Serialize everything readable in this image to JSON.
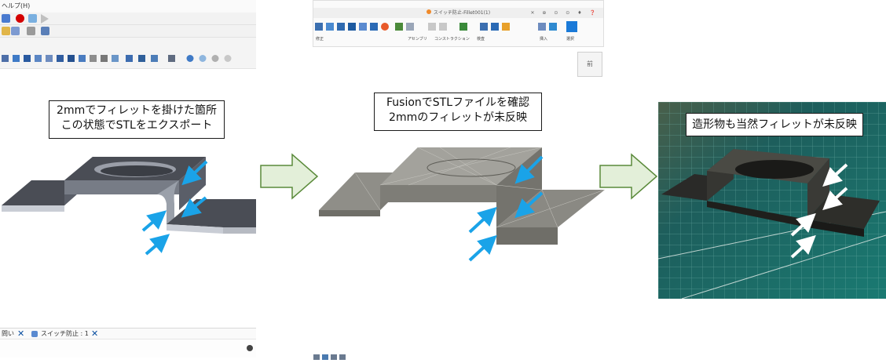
{
  "left_app": {
    "menu_help": "ヘルプ(H)",
    "tabs": [
      {
        "label": "問い"
      },
      {
        "label": "スイッチ防止 : 1"
      }
    ]
  },
  "middle_app": {
    "title": "スイッチ防止-Fillet001(1)",
    "toolbar_groups": [
      "修正",
      "アセンブリ",
      "コンストラクション",
      "検査",
      "挿入",
      "選択"
    ],
    "orientation_cube_label": "前"
  },
  "callouts": {
    "left": [
      "2mmでフィレットを掛けた箇所",
      "この状態でSTLをエクスポート"
    ],
    "middle": [
      "FusionでSTLファイルを確認",
      "2mmのフィレットが未反映"
    ],
    "right": "造形物も当然フィレットが未反映"
  },
  "colors": {
    "arrow_blue": "#1aa3e8",
    "flow_arrow_fill": "#e3efd9",
    "flow_arrow_stroke": "#5a8a3a",
    "cad_part": "#4a4d55",
    "stl_part": "#8f8e88",
    "cutting_mat": "#1f6e6a"
  }
}
